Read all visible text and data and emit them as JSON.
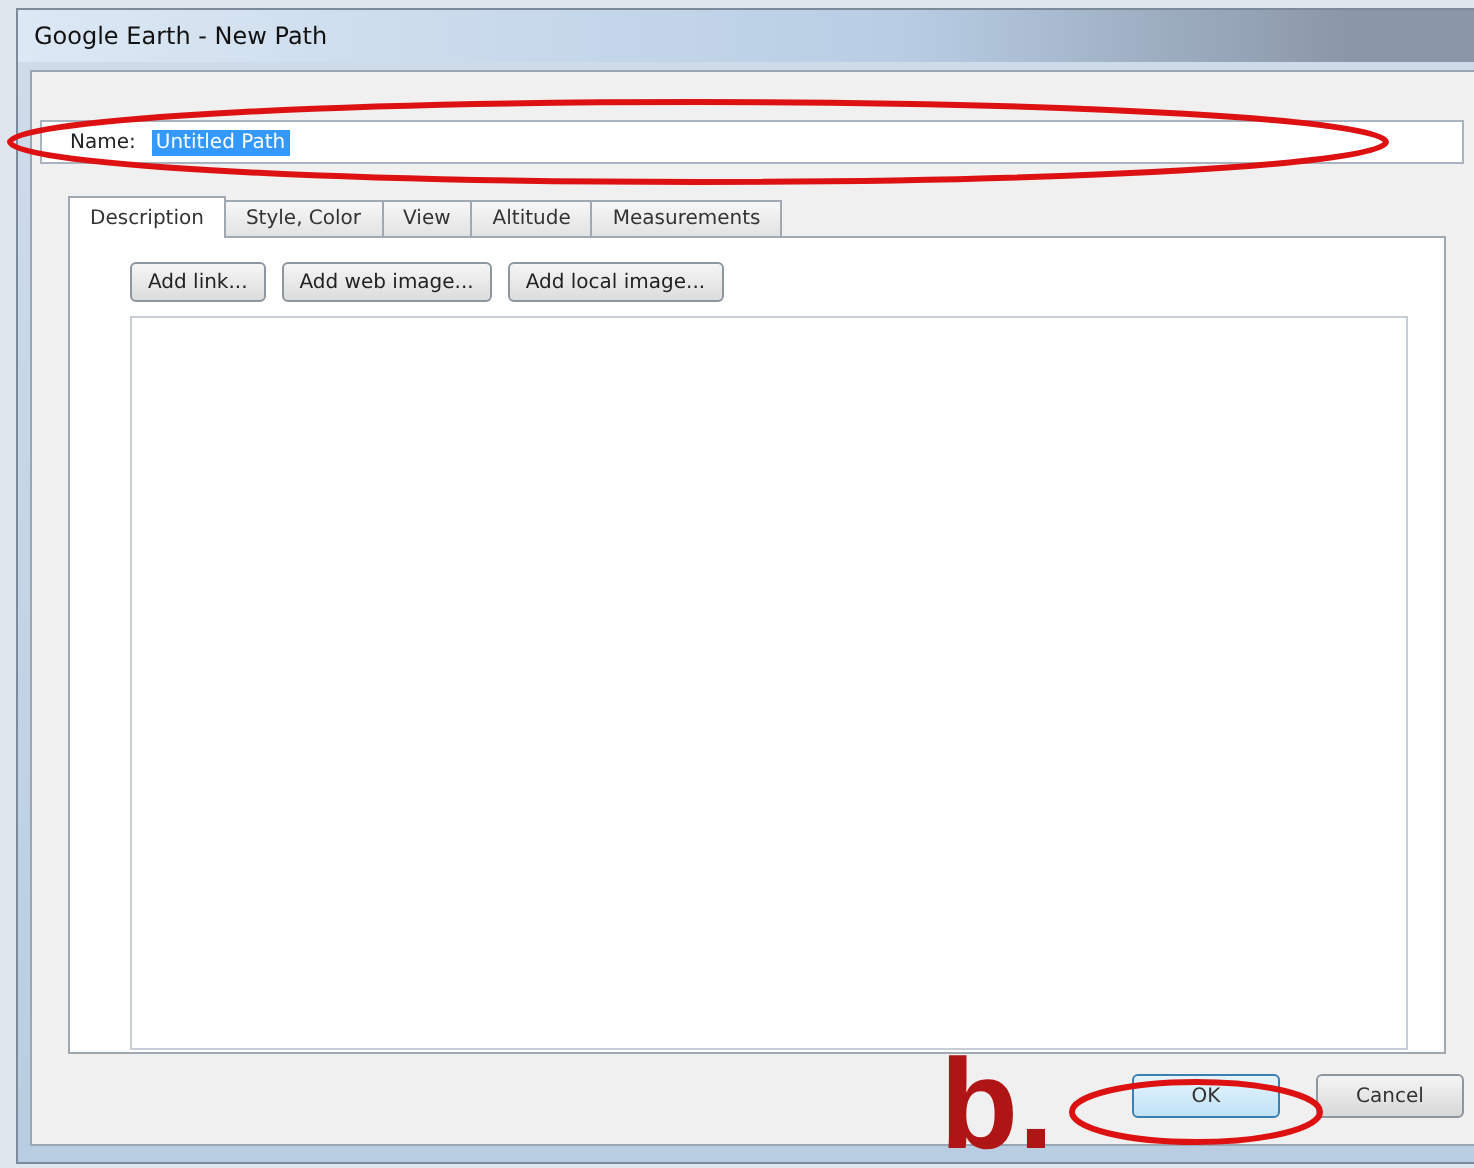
{
  "window": {
    "title": "Google Earth - New Path"
  },
  "name_field": {
    "label": "Name:",
    "value": "Untitled Path",
    "selected": true
  },
  "tabs": [
    {
      "label": "Description",
      "selected": true
    },
    {
      "label": "Style, Color",
      "selected": false
    },
    {
      "label": "View",
      "selected": false
    },
    {
      "label": "Altitude",
      "selected": false
    },
    {
      "label": "Measurements",
      "selected": false
    }
  ],
  "toolbar_buttons": [
    "Add link...",
    "Add web image...",
    "Add local image..."
  ],
  "annotation_label": "b.",
  "buttons": [
    {
      "label": "OK",
      "default": true
    },
    {
      "label": "Cancel",
      "default": false
    }
  ]
}
